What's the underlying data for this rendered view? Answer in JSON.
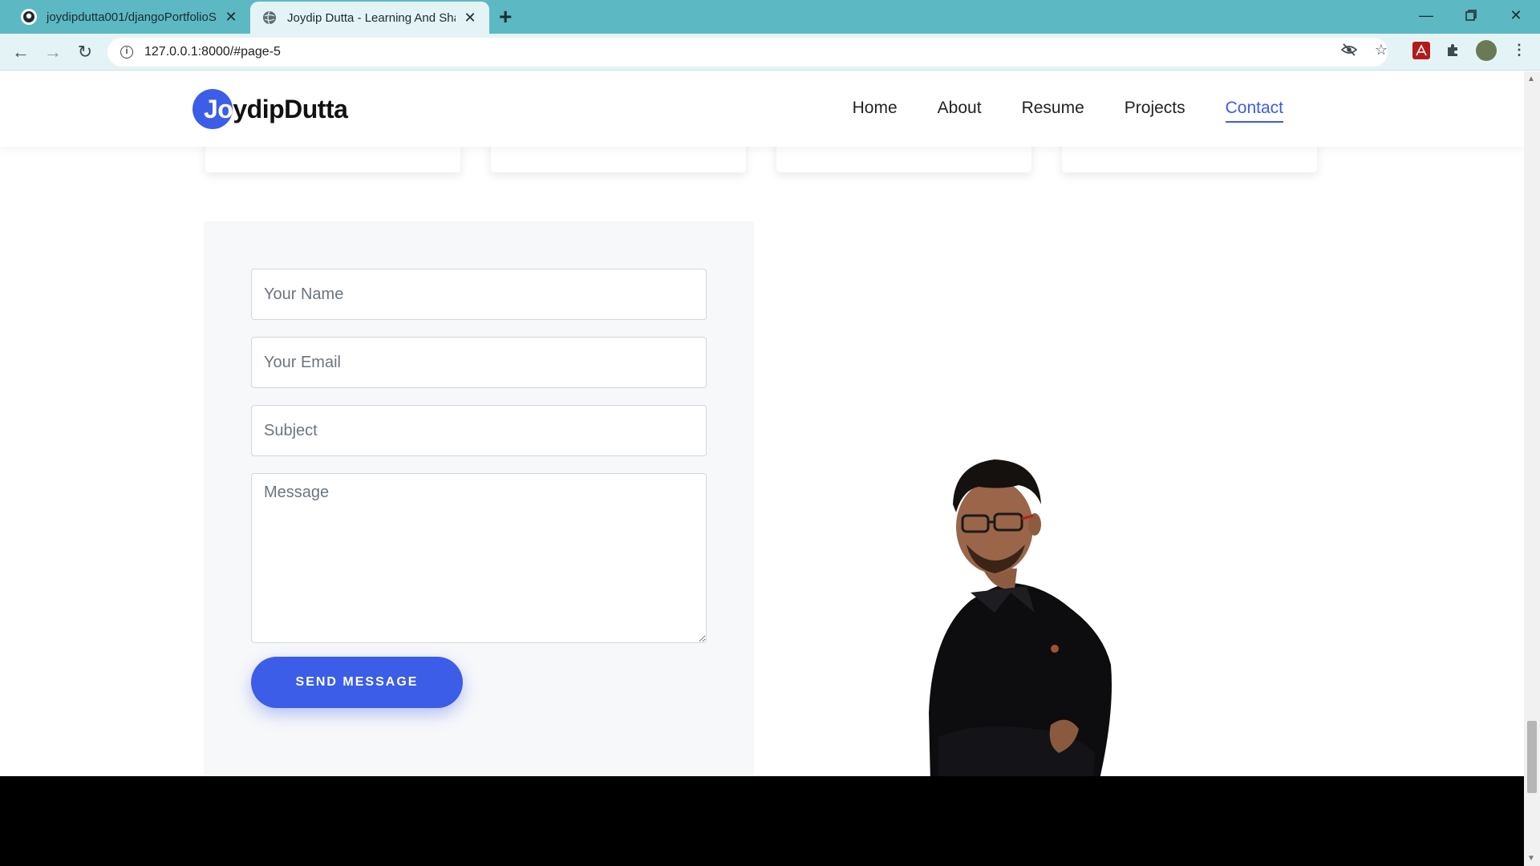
{
  "browser": {
    "tabs": [
      {
        "title": "joydipdutta001/djangoPortfolioS",
        "active": false
      },
      {
        "title": "Joydip Dutta - Learning And Shar",
        "active": true
      }
    ],
    "new_tab_label": "+",
    "url": "127.0.0.1:8000/#page-5"
  },
  "site": {
    "logo": {
      "prefix": "Jo",
      "rest": "ydipDutta"
    },
    "nav": [
      {
        "label": "Home"
      },
      {
        "label": "About"
      },
      {
        "label": "Resume"
      },
      {
        "label": "Projects"
      },
      {
        "label": "Contact",
        "active": true
      }
    ],
    "accent_color": "#3b5de7"
  },
  "contact_form": {
    "name_placeholder": "Your Name",
    "email_placeholder": "Your Email",
    "subject_placeholder": "Subject",
    "message_placeholder": "Message",
    "send_label": "SEND MESSAGE"
  }
}
